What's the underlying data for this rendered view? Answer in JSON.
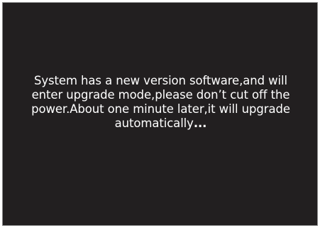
{
  "screen": {
    "background_color": "#221f20",
    "text_color": "#ffffff"
  },
  "message": {
    "lines": [
      "System has a new version software,and will",
      "enter upgrade mode,please don’t cut off the",
      "power.About one minute later,it will upgrade",
      "automatically"
    ],
    "ellipsis": "..."
  }
}
